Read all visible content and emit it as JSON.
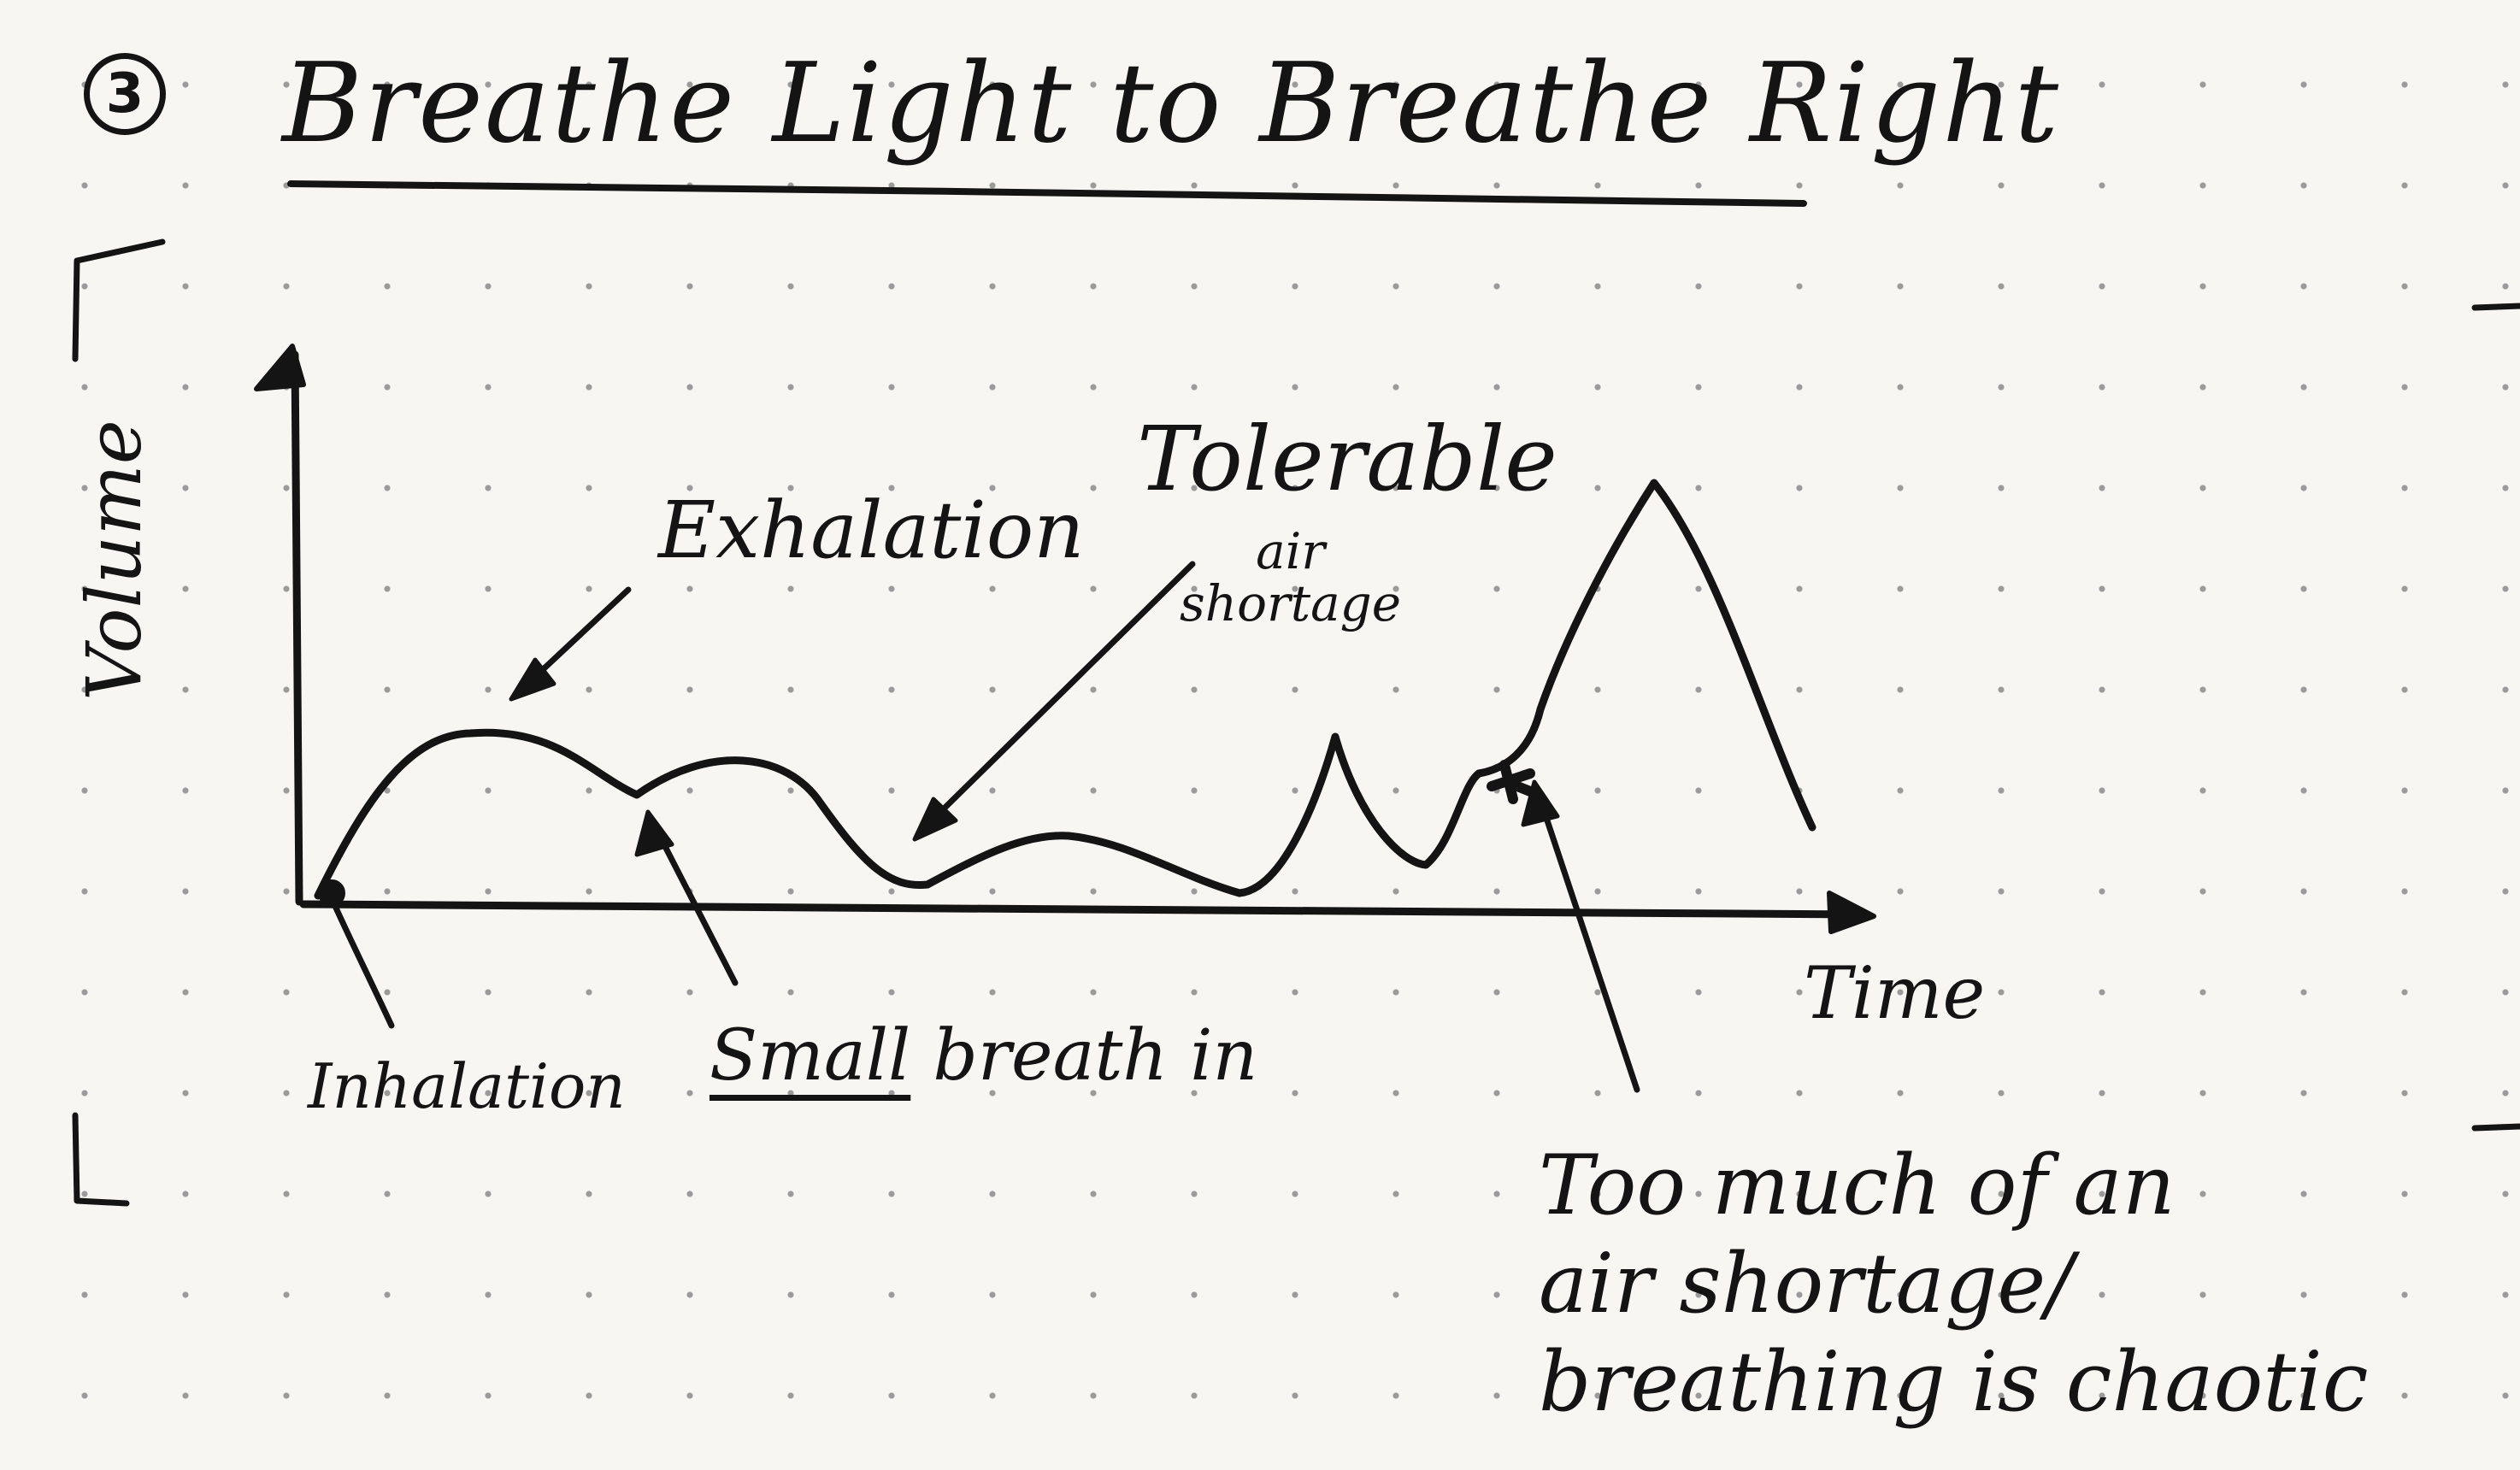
{
  "title": {
    "number": "3",
    "text": "Breathe Light to Breathe Right"
  },
  "axes": {
    "y_label": "Volume",
    "x_label": "Time"
  },
  "annotations": {
    "exhalation": "Exhalation",
    "tolerable": "Tolerable",
    "tolerable_detail_1": "air",
    "tolerable_detail_2": "shortage",
    "inhalation": "Inhalation",
    "small_word": "Small",
    "small_rest": "breath in",
    "too_much_1": "Too much of an",
    "too_much_2": "air shortage/",
    "too_much_3": "breathing is chaotic"
  },
  "colors": {
    "ink": "#141414",
    "paper": "#f7f6f3",
    "dots": "#9a9a9a"
  }
}
